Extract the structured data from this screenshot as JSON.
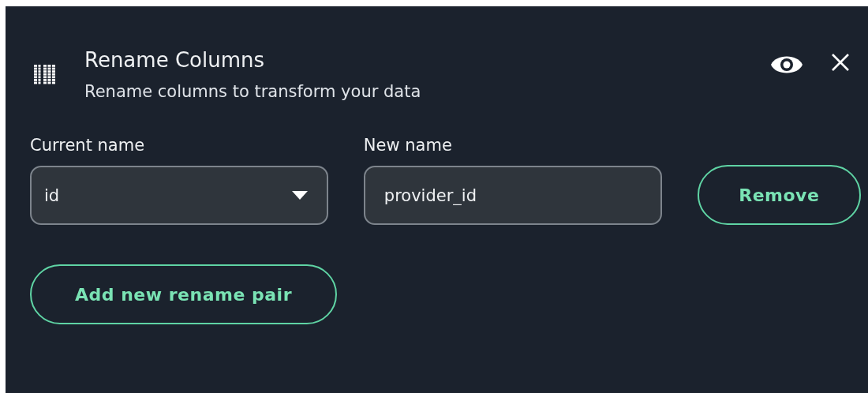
{
  "header": {
    "title": "Rename Columns",
    "subtitle": "Rename columns to transform your data"
  },
  "rename_pairs": [
    {
      "current_label": "Current name",
      "current_value": "id",
      "new_label": "New name",
      "new_value": "provider_id",
      "remove_button": "Remove"
    }
  ],
  "add_button": "Add new rename pair"
}
